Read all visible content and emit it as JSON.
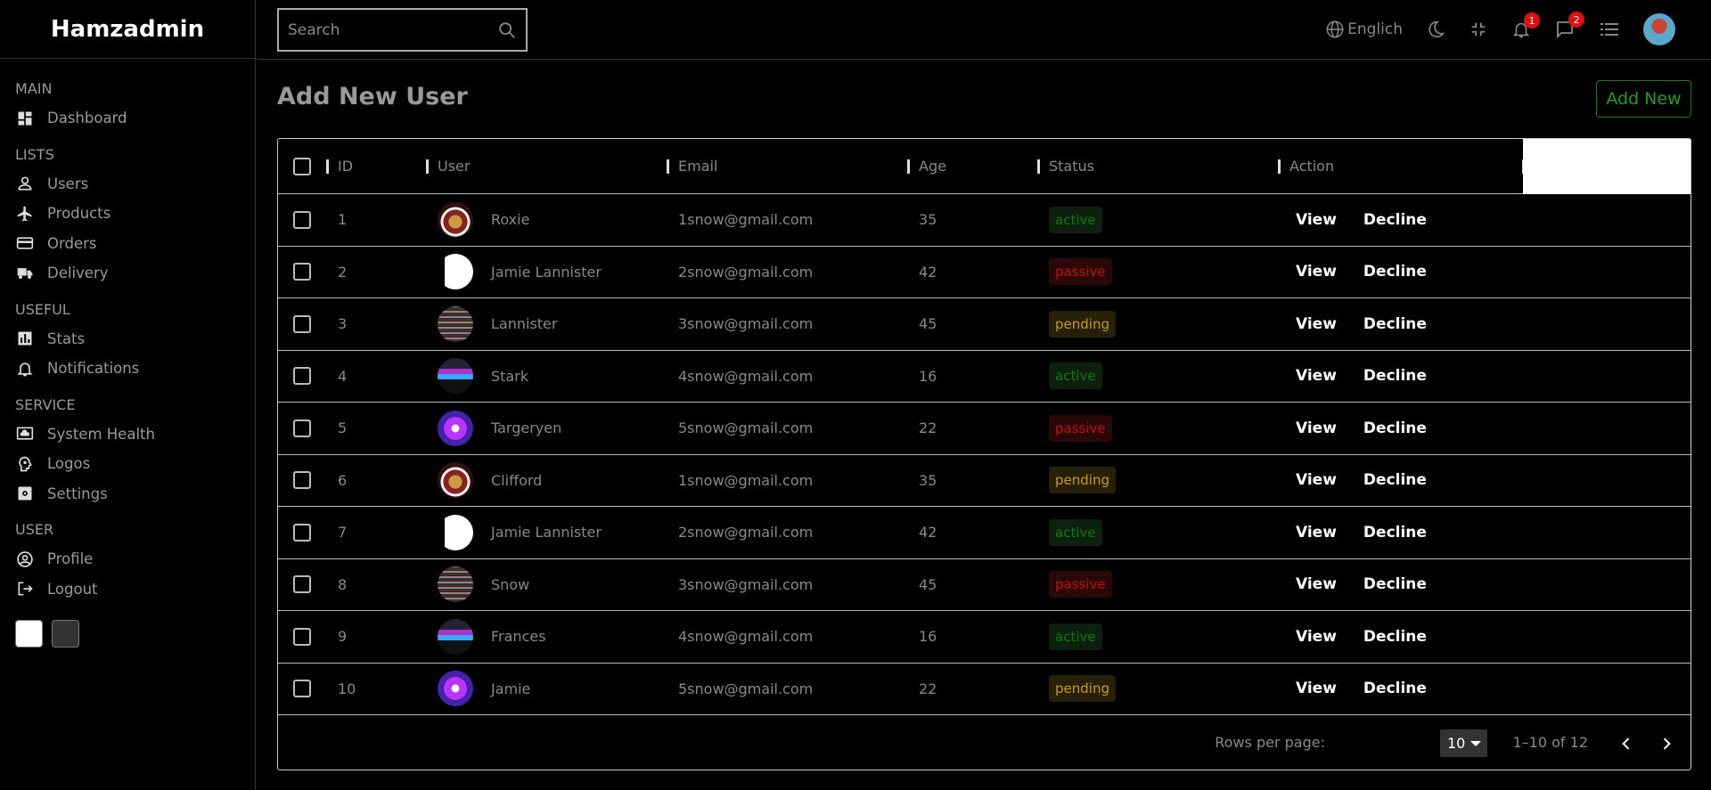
{
  "app": {
    "title": "Hamzadmin"
  },
  "search": {
    "placeholder": "Search"
  },
  "topbar": {
    "language": "Englich",
    "notifications_count": "1",
    "messages_count": "2"
  },
  "sidebar": {
    "sections": [
      {
        "title": "MAIN",
        "items": [
          {
            "label": "Dashboard",
            "icon": "dashboard-icon"
          }
        ]
      },
      {
        "title": "LISTS",
        "items": [
          {
            "label": "Users",
            "icon": "user-icon"
          },
          {
            "label": "Products",
            "icon": "airplane-icon"
          },
          {
            "label": "Orders",
            "icon": "credit-card-icon"
          },
          {
            "label": "Delivery",
            "icon": "truck-icon"
          }
        ]
      },
      {
        "title": "USEFUL",
        "items": [
          {
            "label": "Stats",
            "icon": "bar-chart-icon"
          },
          {
            "label": "Notifications",
            "icon": "bell-icon"
          }
        ]
      },
      {
        "title": "SERVICE",
        "items": [
          {
            "label": "System Health",
            "icon": "cloud-monitor-icon"
          },
          {
            "label": "Logos",
            "icon": "brain-icon"
          },
          {
            "label": "Settings",
            "icon": "settings-icon"
          }
        ]
      },
      {
        "title": "USER",
        "items": [
          {
            "label": "Profile",
            "icon": "account-circle-icon"
          },
          {
            "label": "Logout",
            "icon": "logout-icon"
          }
        ]
      }
    ]
  },
  "main": {
    "title": "Add New User",
    "add_new": "Add New",
    "columns": {
      "id": "ID",
      "user": "User",
      "email": "Email",
      "age": "Age",
      "status": "Status",
      "action": "Action"
    },
    "actions": {
      "view": "View",
      "decline": "Decline"
    },
    "rows": [
      {
        "id": "1",
        "user": "Roxie",
        "email": "1snow@gmail.com",
        "age": "35",
        "status": "active"
      },
      {
        "id": "2",
        "user": "Jamie Lannister",
        "email": "2snow@gmail.com",
        "age": "42",
        "status": "passive"
      },
      {
        "id": "3",
        "user": "Lannister",
        "email": "3snow@gmail.com",
        "age": "45",
        "status": "pending"
      },
      {
        "id": "4",
        "user": "Stark",
        "email": "4snow@gmail.com",
        "age": "16",
        "status": "active"
      },
      {
        "id": "5",
        "user": "Targeryen",
        "email": "5snow@gmail.com",
        "age": "22",
        "status": "passive"
      },
      {
        "id": "6",
        "user": "Clifford",
        "email": "1snow@gmail.com",
        "age": "35",
        "status": "pending"
      },
      {
        "id": "7",
        "user": "Jamie Lannister",
        "email": "2snow@gmail.com",
        "age": "42",
        "status": "active"
      },
      {
        "id": "8",
        "user": "Snow",
        "email": "3snow@gmail.com",
        "age": "45",
        "status": "passive"
      },
      {
        "id": "9",
        "user": "Frances",
        "email": "4snow@gmail.com",
        "age": "16",
        "status": "active"
      },
      {
        "id": "10",
        "user": "Jamie",
        "email": "5snow@gmail.com",
        "age": "22",
        "status": "pending"
      }
    ],
    "footer": {
      "rows_per_page_label": "Rows per page:",
      "rows_per_page": "10",
      "range": "1–10 of 12"
    }
  }
}
